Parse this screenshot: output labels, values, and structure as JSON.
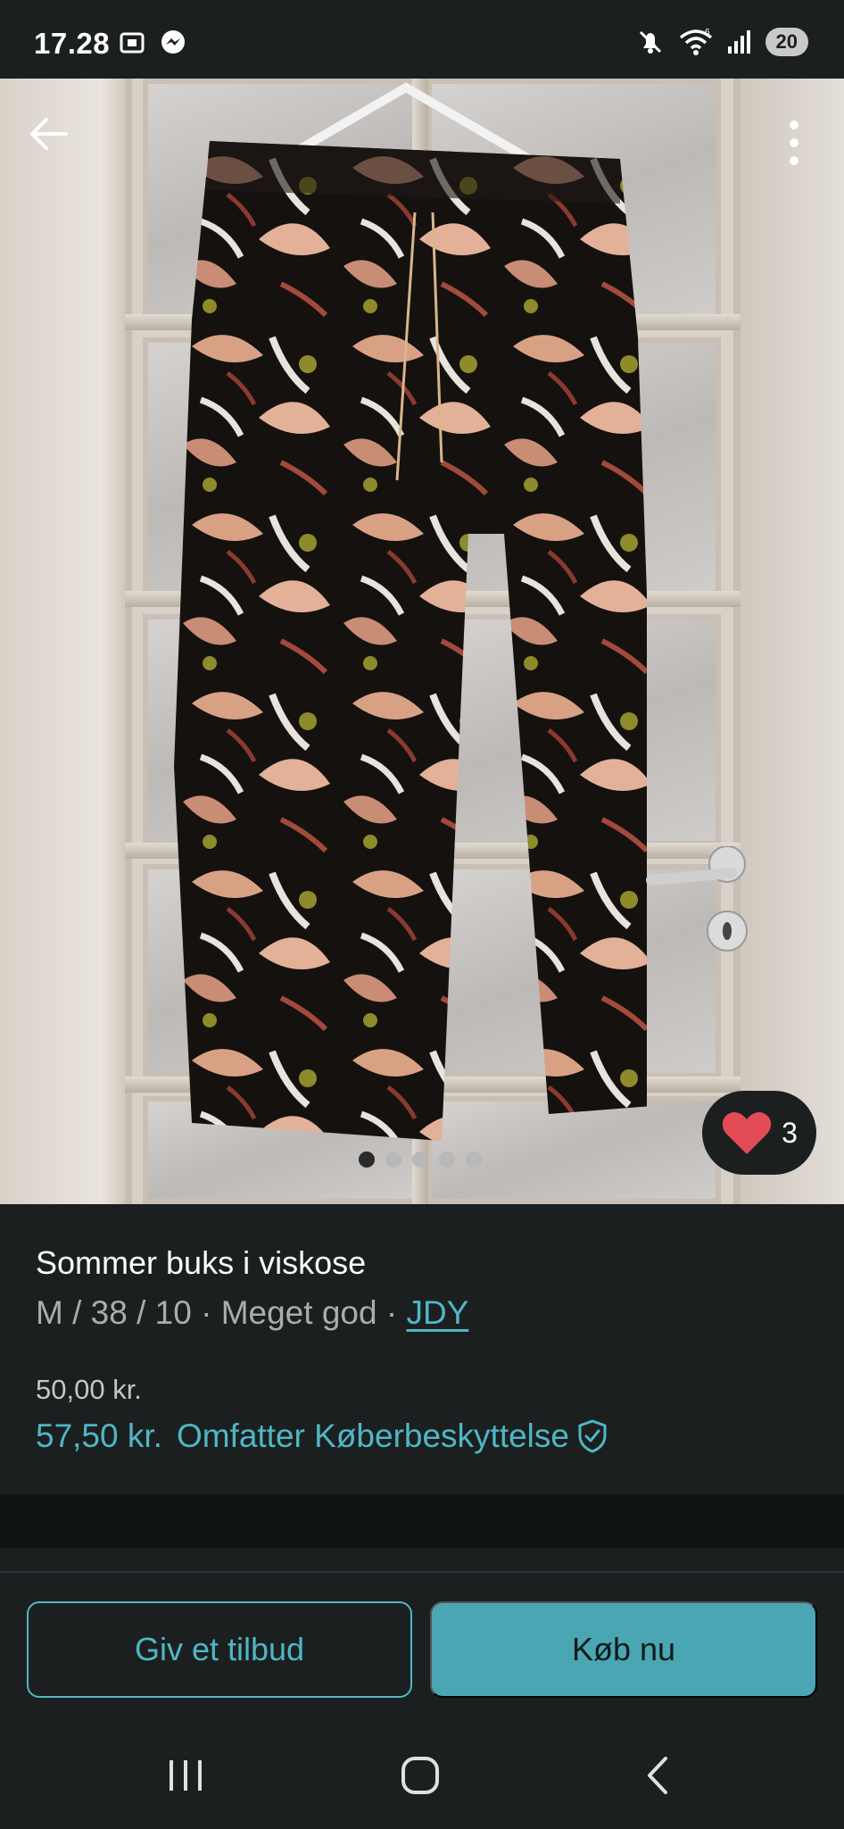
{
  "status_bar": {
    "time": "17.28",
    "battery": "20",
    "icons": [
      "screenshot-icon",
      "messenger-icon",
      "mute-icon",
      "wifi-icon",
      "signal-icon"
    ]
  },
  "gallery": {
    "like_count": "3",
    "image_count": 5,
    "active_image": 1
  },
  "listing": {
    "title": "Sommer buks i viskose",
    "size": "M / 38 / 10",
    "separator": " · ",
    "condition": "Meget god",
    "brand": "JDY",
    "price": "50,00 kr.",
    "price_with_protection": "57,50 kr.",
    "protection_label": "Omfatter Køberbeskyttelse"
  },
  "actions": {
    "offer_label": "Giv et tilbud",
    "buy_label": "Køb nu"
  },
  "colors": {
    "accent": "#4fb7c4",
    "buy_button": "#4aa6b2",
    "background": "#1b1f20",
    "like_heart": "#e34b57"
  }
}
